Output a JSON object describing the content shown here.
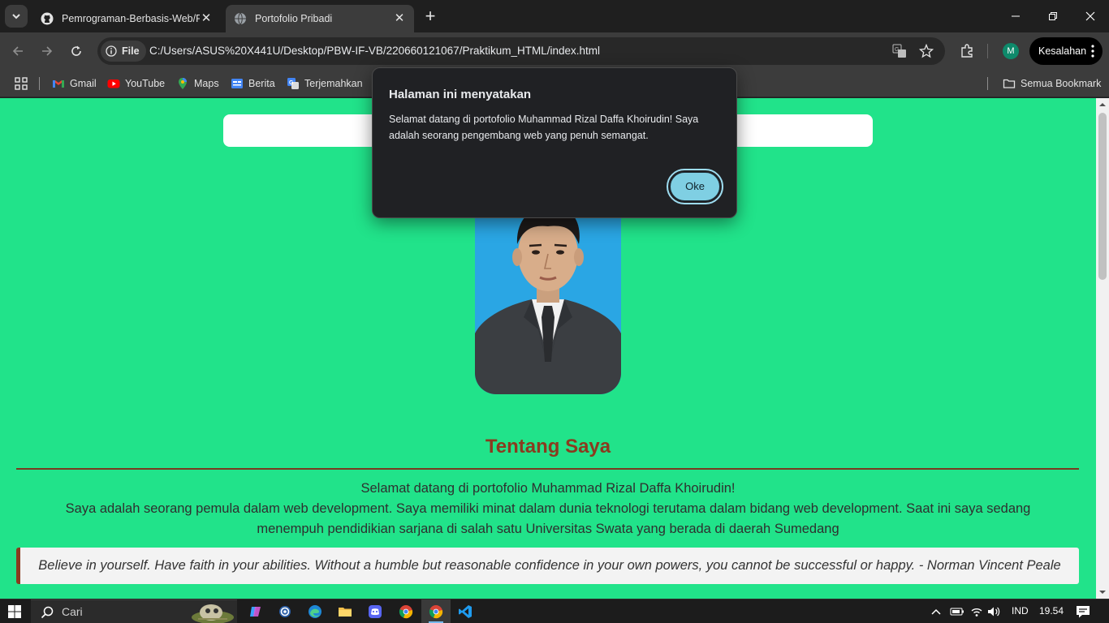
{
  "browser": {
    "tabs": [
      {
        "title": "Pemrograman-Berbasis-Web/PBW",
        "icon": "github-icon",
        "active": false
      },
      {
        "title": "Portofolio Pribadi",
        "icon": "globe-icon",
        "active": true
      }
    ],
    "address": {
      "chip_label": "File",
      "url": "C:/Users/ASUS%20X441U/Desktop/PBW-IF-VB/220660121067/Praktikum_HTML/index.html"
    },
    "profile_initial": "M",
    "error_label": "Kesalahan",
    "bookmarks": [
      {
        "label": "Gmail",
        "icon": "gmail-icon"
      },
      {
        "label": "YouTube",
        "icon": "youtube-icon"
      },
      {
        "label": "Maps",
        "icon": "maps-icon"
      },
      {
        "label": "Berita",
        "icon": "news-icon"
      },
      {
        "label": "Terjemahkan",
        "icon": "translate-icon"
      }
    ],
    "all_bookmarks_label": "Semua Bookmark"
  },
  "dialog": {
    "title": "Halaman ini menyatakan",
    "message": "Selamat datang di portofolio Muhammad Rizal Daffa Khoirudin! Saya adalah seorang pengembang web yang penuh semangat.",
    "ok_label": "Oke"
  },
  "page": {
    "section_title": "Tentang Saya",
    "about_line1": "Selamat datang di portofolio Muhammad Rizal Daffa Khoirudin!",
    "about_line2": "Saya adalah seorang pemula dalam web development. Saya memiliki minat dalam dunia teknologi terutama dalam bidang web development. Saat ini saya sedang menempuh pendidikian sarjana di salah satu Universitas Swata yang berada di daerah Sumedang",
    "quote": "Believe in yourself. Have faith in your abilities. Without a humble but reasonable confidence in your own powers, you cannot be successful or happy. - Norman Vincent Peale",
    "colors": {
      "background": "#21e38a",
      "accent": "#8a3b1f"
    }
  },
  "taskbar": {
    "search_placeholder": "Cari",
    "language": "IND",
    "time": "19.54"
  }
}
